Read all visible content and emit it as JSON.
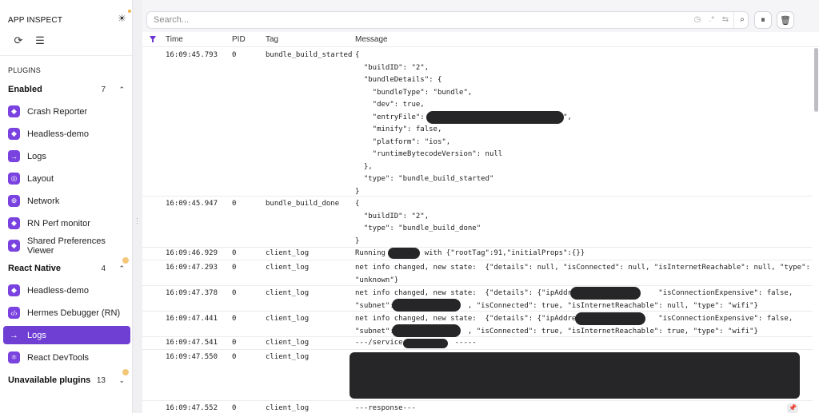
{
  "app": {
    "title": "APP INSPECT",
    "theme_icon": "sun-icon",
    "reload_icon": "reload-icon",
    "menu_icon": "menu-icon"
  },
  "sidebar": {
    "section_label": "PLUGINS",
    "groups": [
      {
        "label": "Enabled",
        "count": "7",
        "chevron": "⌃"
      },
      {
        "label": "React Native",
        "count": "4",
        "chevron": "⌃"
      },
      {
        "label": "Unavailable plugins",
        "count": "13",
        "chevron": "⌄"
      }
    ],
    "enabled_items": [
      {
        "label": "Crash Reporter",
        "icon": "plugin-cube-icon"
      },
      {
        "label": "Headless-demo",
        "icon": "plugin-cube-icon"
      },
      {
        "label": "Logs",
        "icon": "arrow-right-icon"
      },
      {
        "label": "Layout",
        "icon": "target-icon"
      },
      {
        "label": "Network",
        "icon": "globe-icon"
      },
      {
        "label": "RN Perf monitor",
        "icon": "plugin-cube-icon"
      },
      {
        "label": "Shared Preferences Viewer",
        "icon": "plugin-cube-icon"
      }
    ],
    "rn_items": [
      {
        "label": "Headless-demo",
        "icon": "plugin-cube-icon"
      },
      {
        "label": "Hermes Debugger (RN)",
        "icon": "code-icon"
      },
      {
        "label": "Logs",
        "icon": "arrow-right-icon",
        "active": true
      },
      {
        "label": "React DevTools",
        "icon": "react-icon"
      }
    ]
  },
  "search": {
    "placeholder": "Search...",
    "value": ""
  },
  "columns": {
    "time": "Time",
    "pid": "PID",
    "tag": "Tag",
    "message": "Message"
  },
  "rows": [
    {
      "time": "16:09:45.793",
      "pid": "0",
      "tag": "bundle_build_started",
      "message": "{\n  \"buildID\": \"2\",\n  \"bundleDetails\": {\n    \"bundleType\": \"bundle\",\n    \"dev\": true,\n    \"entryFile\": \"                              \",\n    \"minify\": false,\n    \"platform\": \"ios\",\n    \"runtimeBytecodeVersion\": null\n  },\n  \"type\": \"bundle_build_started\"\n}"
    },
    {
      "time": "16:09:45.947",
      "pid": "0",
      "tag": "bundle_build_done",
      "message": "{\n  \"buildID\": \"2\",\n  \"type\": \"bundle_build_done\"\n}"
    },
    {
      "time": "16:09:46.929",
      "pid": "0",
      "tag": "client_log",
      "message": "Running         with {\"rootTag\":91,\"initialProps\":{}}"
    },
    {
      "time": "16:09:47.293",
      "pid": "0",
      "tag": "client_log",
      "message": "net info changed, new state:  {\"details\": null, \"isConnected\": null, \"isInternetReachable\": null, \"type\":\n\"unknown\"}"
    },
    {
      "time": "16:09:47.378",
      "pid": "0",
      "tag": "client_log",
      "message": "net info changed, new state:  {\"details\": {\"ipAddress                 \"isConnectionExpensive\": false,\n\"subnet\":                 , \"isConnected\": true, \"isInternetReachable\": null, \"type\": \"wifi\"}"
    },
    {
      "time": "16:09:47.441",
      "pid": "0",
      "tag": "client_log",
      "message": "net info changed, new state:  {\"details\": {\"ipAddress                 \"isConnectionExpensive\": false,\n\"subnet\":                 , \"isConnected\": true, \"isInternetReachable\": true, \"type\": \"wifi\"}"
    },
    {
      "time": "16:09:47.541",
      "pid": "0",
      "tag": "client_log",
      "message": "---/service/           -----"
    },
    {
      "time": "16:09:47.550",
      "pid": "0",
      "tag": "client_log",
      "message": ""
    },
    {
      "time": "16:09:47.552",
      "pid": "0",
      "tag": "client_log",
      "message": "---response---"
    }
  ],
  "toolbar": {
    "history_icon": "history-icon",
    "regex_icon": "regex-icon",
    "swap_icon": "swap-icon",
    "search_icon": "search-icon",
    "pause_icon": "pause-icon",
    "trash_icon": "trash-icon",
    "filter_icon": "filter-icon",
    "pin_icon": "pin-icon"
  },
  "colors": {
    "accent": "#6f3fd3",
    "plugin_icon": "#7a43e0",
    "notification_dot": "#f4c77a",
    "redaction": "#262628"
  }
}
